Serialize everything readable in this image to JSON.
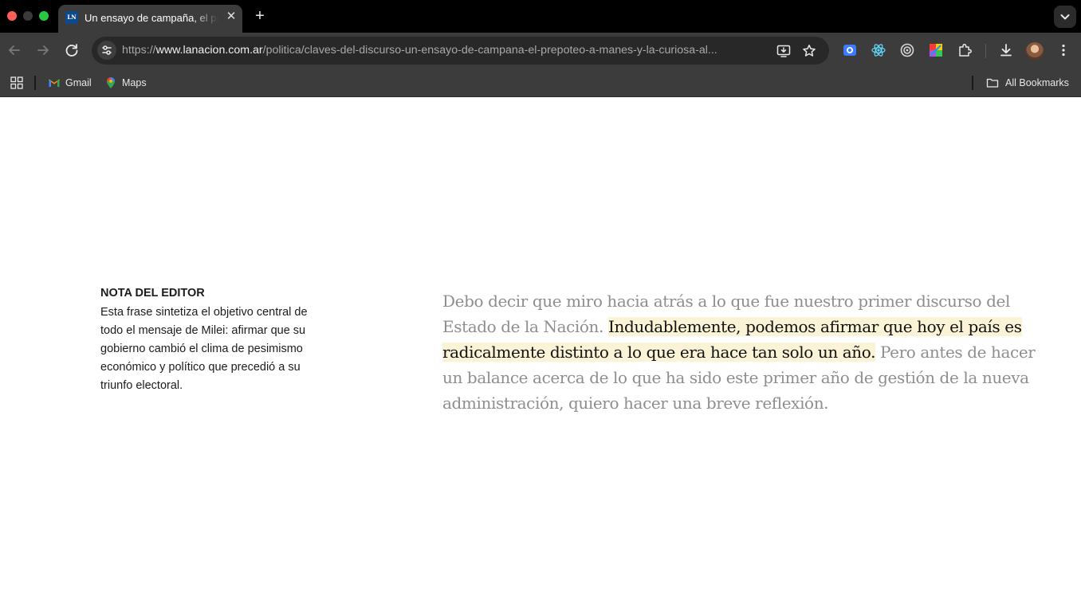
{
  "browser": {
    "tab": {
      "favicon_text": "LN",
      "title": "Un ensayo de campaña, el prepoteo a Manes y la curiosa al..."
    },
    "url": {
      "scheme": "https://",
      "host": "www.lanacion.com.ar",
      "path": "/politica/claves-del-discurso-un-ensayo-de-campana-el-prepoteo-a-manes-y-la-curiosa-al..."
    },
    "bookmarks": [
      {
        "label": "Gmail",
        "icon": "gmail-icon"
      },
      {
        "label": "Maps",
        "icon": "maps-icon"
      }
    ],
    "all_bookmarks_label": "All Bookmarks"
  },
  "article": {
    "editor_note": {
      "heading": "NOTA DEL EDITOR",
      "body": "Esta frase sintetiza el objetivo central de todo el mensaje de Milei: afirmar que su gobierno cambió el clima de pesimismo económico y político que precedió a su triunfo electoral."
    },
    "quote": {
      "before": "Debo decir que miro hacia atrás a lo que fue nuestro primer discurso del Estado de la Nación. ",
      "highlight": "Indudablemente, podemos afirmar que hoy el país es radicalmente distinto a lo que era hace tan solo un año.",
      "after": " Pero antes de hacer un balance acerca de lo que ha sido este primer año de gestión de la nueva administración, quiero hacer una breve reflexión.",
      "highlight_color": "#fbf3d6"
    }
  }
}
